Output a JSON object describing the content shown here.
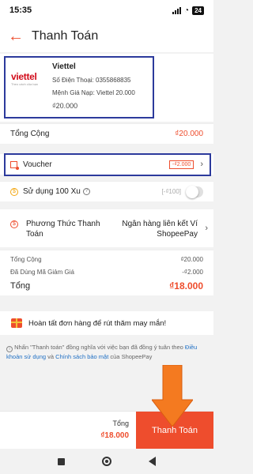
{
  "status_bar": {
    "time": "15:35",
    "battery": "24"
  },
  "header": {
    "title": "Thanh Toán"
  },
  "product": {
    "logo_text": "viettel",
    "logo_subtext": "Theo cách của bạn",
    "name": "Viettel",
    "phone_line": "Số Điện Thoại: 0355868835",
    "topup_line": "Mệnh Giá Nạp: Viettel 20.000",
    "price": "₫20.000"
  },
  "total_row": {
    "label": "Tổng Cộng",
    "amount": "₫20.000"
  },
  "voucher": {
    "label": "Voucher",
    "badge": "-₫2.000"
  },
  "xu": {
    "label": "Sử dụng 100 Xu",
    "value": "[-₫100]"
  },
  "payment_method": {
    "label": "Phương Thức Thanh Toán",
    "value": "Ngân hàng liên kết Ví ShopeePay"
  },
  "summary": {
    "rows": [
      {
        "label": "Tổng Cộng",
        "value": "₫20.000"
      },
      {
        "label": "Đã Dùng Mã Giảm Giá",
        "value": "-₫2.000"
      }
    ],
    "total_label": "Tổng",
    "total_value": "₫18.000"
  },
  "promo": {
    "text": "Hoàn tất đơn hàng để rút thăm may mắn!"
  },
  "terms": {
    "prefix": "Nhấn \"Thanh toán\" đồng nghĩa với việc bạn đã đồng ý tuân theo",
    "link1": "Điều khoản sử dụng",
    "middle": "và",
    "link2": "Chính sách bảo mật",
    "suffix": "của ShopeePay"
  },
  "bottom_bar": {
    "total_label": "Tổng",
    "total_value": "₫18.000",
    "pay_button": "Thanh Toán"
  },
  "colors": {
    "accent": "#ee4d2d",
    "annotation_box": "#2c3a9c",
    "arrow": "#f47a20",
    "link": "#1f6fc4"
  }
}
